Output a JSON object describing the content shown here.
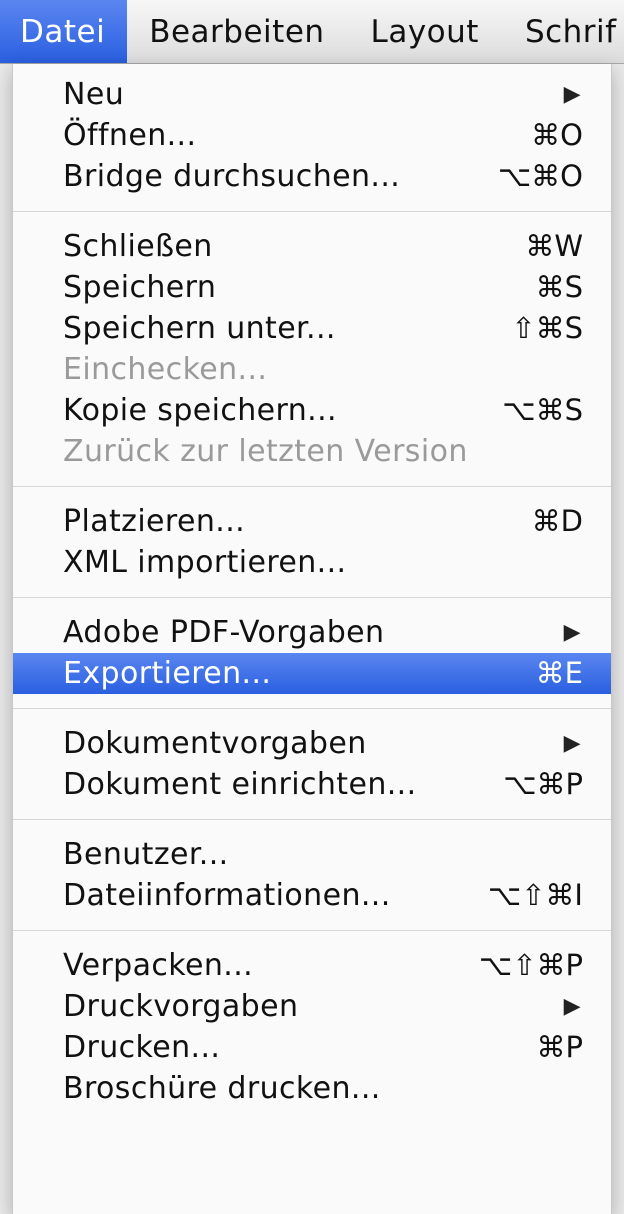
{
  "menubar": {
    "items": [
      {
        "label": "Datei",
        "active": true
      },
      {
        "label": "Bearbeiten",
        "active": false
      },
      {
        "label": "Layout",
        "active": false
      },
      {
        "label": "Schrif",
        "active": false
      }
    ]
  },
  "menu": {
    "groups": [
      [
        {
          "label": "Neu",
          "shortcut": "",
          "submenu": true,
          "enabled": true
        },
        {
          "label": "Öffnen...",
          "shortcut": "⌘O",
          "submenu": false,
          "enabled": true
        },
        {
          "label": "Bridge durchsuchen...",
          "shortcut": "⌥⌘O",
          "submenu": false,
          "enabled": true
        }
      ],
      [
        {
          "label": "Schließen",
          "shortcut": "⌘W",
          "submenu": false,
          "enabled": true
        },
        {
          "label": "Speichern",
          "shortcut": "⌘S",
          "submenu": false,
          "enabled": true
        },
        {
          "label": "Speichern unter...",
          "shortcut": "⇧⌘S",
          "submenu": false,
          "enabled": true
        },
        {
          "label": "Einchecken...",
          "shortcut": "",
          "submenu": false,
          "enabled": false
        },
        {
          "label": "Kopie speichern...",
          "shortcut": "⌥⌘S",
          "submenu": false,
          "enabled": true
        },
        {
          "label": "Zurück zur letzten Version",
          "shortcut": "",
          "submenu": false,
          "enabled": false
        }
      ],
      [
        {
          "label": "Platzieren...",
          "shortcut": "⌘D",
          "submenu": false,
          "enabled": true
        },
        {
          "label": "XML importieren...",
          "shortcut": "",
          "submenu": false,
          "enabled": true
        }
      ],
      [
        {
          "label": "Adobe PDF-Vorgaben",
          "shortcut": "",
          "submenu": true,
          "enabled": true
        },
        {
          "label": "Exportieren...",
          "shortcut": "⌘E",
          "submenu": false,
          "enabled": true,
          "highlighted": true
        }
      ],
      [
        {
          "label": "Dokumentvorgaben",
          "shortcut": "",
          "submenu": true,
          "enabled": true
        },
        {
          "label": "Dokument einrichten...",
          "shortcut": "⌥⌘P",
          "submenu": false,
          "enabled": true
        }
      ],
      [
        {
          "label": "Benutzer...",
          "shortcut": "",
          "submenu": false,
          "enabled": true
        },
        {
          "label": "Dateiinformationen...",
          "shortcut": "⌥⇧⌘I",
          "submenu": false,
          "enabled": true
        }
      ],
      [
        {
          "label": "Verpacken...",
          "shortcut": "⌥⇧⌘P",
          "submenu": false,
          "enabled": true
        },
        {
          "label": "Druckvorgaben",
          "shortcut": "",
          "submenu": true,
          "enabled": true
        },
        {
          "label": "Drucken...",
          "shortcut": "⌘P",
          "submenu": false,
          "enabled": true
        },
        {
          "label": "Broschüre drucken...",
          "shortcut": "",
          "submenu": false,
          "enabled": true
        }
      ]
    ]
  },
  "icons": {
    "submenu_arrow": "submenu-arrow-icon"
  },
  "colors": {
    "highlight": "#3a6ee8",
    "disabled_text": "#9a9a9a"
  }
}
